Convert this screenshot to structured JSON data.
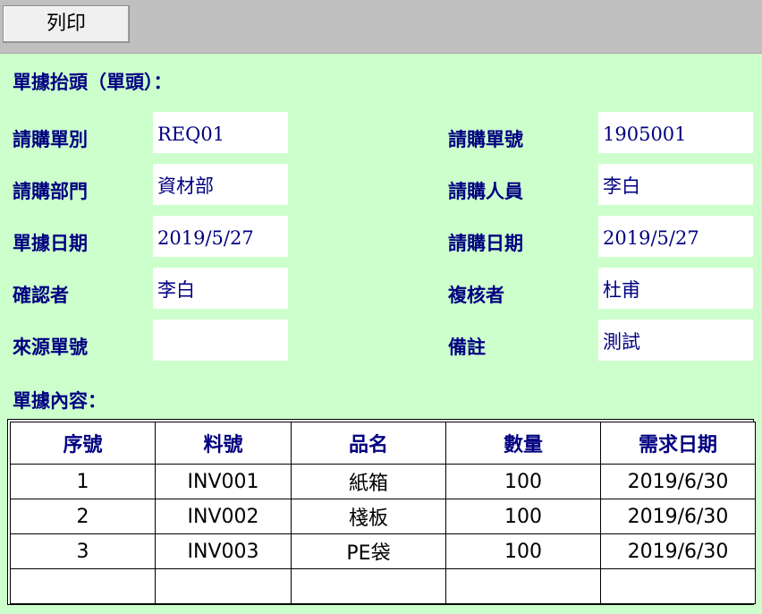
{
  "toolbar": {
    "print_label": "列印"
  },
  "header_section": {
    "title": "單據抬頭（單頭）："
  },
  "fields": {
    "req_type": {
      "label": "請購單別",
      "value": "REQ01"
    },
    "req_no": {
      "label": "請購單號",
      "value": "1905001"
    },
    "req_dept": {
      "label": "請購部門",
      "value": "資材部"
    },
    "requester": {
      "label": "請購人員",
      "value": "李白"
    },
    "doc_date": {
      "label": "單據日期",
      "value": "2019/5/27"
    },
    "req_date": {
      "label": "請購日期",
      "value": "2019/5/27"
    },
    "confirmer": {
      "label": "確認者",
      "value": "李白"
    },
    "reviewer": {
      "label": "複核者",
      "value": "杜甫"
    },
    "source_no": {
      "label": "來源單號",
      "value": ""
    },
    "remark": {
      "label": "備註",
      "value": "測試"
    }
  },
  "detail_section": {
    "title": "單據內容："
  },
  "detail_table": {
    "columns": [
      "序號",
      "料號",
      "品名",
      "數量",
      "需求日期"
    ],
    "rows": [
      [
        "1",
        "INV001",
        "紙箱",
        "100",
        "2019/6/30"
      ],
      [
        "2",
        "INV002",
        "棧板",
        "100",
        "2019/6/30"
      ],
      [
        "3",
        "INV003",
        "PE袋",
        "100",
        "2019/6/30"
      ],
      [
        "",
        "",
        "",
        "",
        ""
      ]
    ]
  }
}
